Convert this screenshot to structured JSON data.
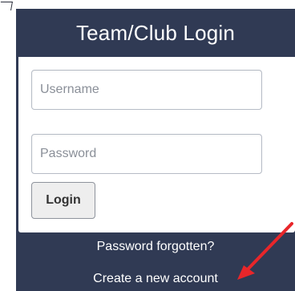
{
  "login": {
    "title": "Team/Club Login",
    "username_placeholder": "Username",
    "password_placeholder": "Password",
    "login_button": "Login",
    "forgot_link": "Password forgotten?",
    "create_link": "Create a new account"
  },
  "colors": {
    "panel": "#303a54",
    "annotation_arrow": "#e8262a"
  }
}
